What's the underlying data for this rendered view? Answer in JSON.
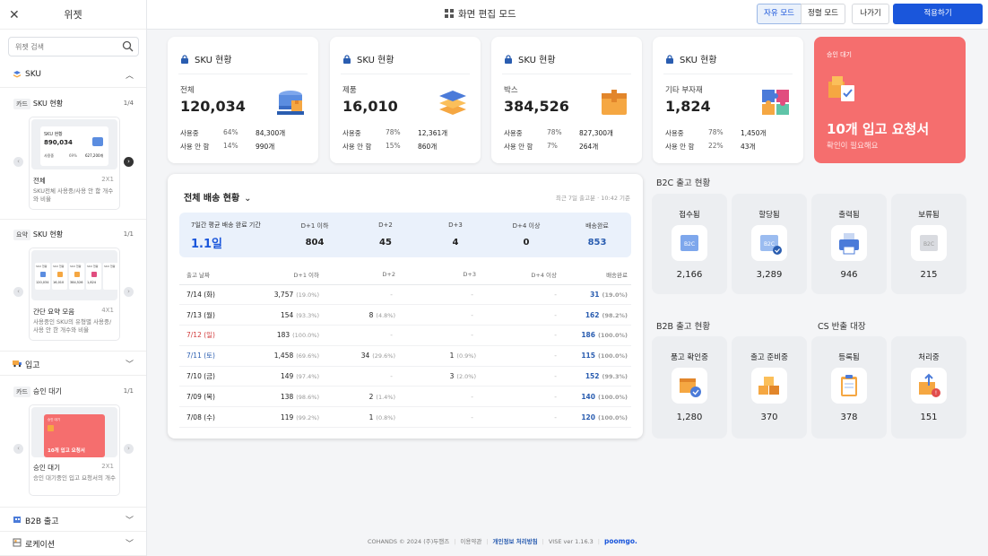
{
  "sidebar": {
    "title": "위젯",
    "search_placeholder": "위젯 검색",
    "sections": {
      "sku": "SKU",
      "inbound": "입고",
      "b2b": "B2B 출고",
      "location": "로케이션"
    },
    "groups": [
      {
        "tag": "카드",
        "title": "SKU 현황",
        "count": "1/4",
        "preview_title": "SKU 현황",
        "preview_value": "890,034",
        "preview_row_label": "사용중",
        "preview_row_pct": "69%",
        "preview_row_count": "627,200개",
        "name": "전체",
        "size": "2X1",
        "desc": "SKU전체 사용중/사용 안 함 개수와 비율"
      },
      {
        "tag": "요약",
        "title": "SKU 현황",
        "count": "1/1",
        "preview_labels": [
          "SKU 현황",
          "SKU 현황",
          "SKU 현황",
          "SKU 현황",
          "SKU 현황"
        ],
        "preview_values": [
          "120,034",
          "16,010",
          "384,526",
          "1,824",
          ""
        ],
        "name": "간단 요약 모음",
        "size": "4X1",
        "desc": "사용중인 SKU의 유형별 사용중/사용 안 한 개수와 비율"
      },
      {
        "tag": "카드",
        "title": "승인 대기",
        "count": "1/1",
        "preview_label": "승인 대기",
        "preview_title": "10개 입고 요청서",
        "name": "승인 대기",
        "size": "2X1",
        "desc": "승인 대기중인 입고 요청서의 개수"
      }
    ]
  },
  "topbar": {
    "mode_title": "화면 편집 모드",
    "free_mode": "자유 모드",
    "align_mode": "정렬 모드",
    "exit": "나가기",
    "apply": "적용하기"
  },
  "sku_cards": [
    {
      "title": "SKU 현황",
      "label": "전체",
      "value": "120,034",
      "used_label": "사용중",
      "used_pct": "64%",
      "used_count": "84,300개",
      "unused_label": "사용 안 함",
      "unused_pct": "14%",
      "unused_count": "990개",
      "icon": "pallet-box-icon"
    },
    {
      "title": "SKU 현황",
      "label": "제품",
      "value": "16,010",
      "used_label": "사용중",
      "used_pct": "78%",
      "used_count": "12,361개",
      "unused_label": "사용 안 함",
      "unused_pct": "15%",
      "unused_count": "860개",
      "icon": "layers-icon"
    },
    {
      "title": "SKU 현황",
      "label": "박스",
      "value": "384,526",
      "used_label": "사용중",
      "used_pct": "78%",
      "used_count": "827,300개",
      "unused_label": "사용 안 함",
      "unused_pct": "7%",
      "unused_count": "264개",
      "icon": "box-icon"
    },
    {
      "title": "SKU 현황",
      "label": "기타 부자재",
      "value": "1,824",
      "used_label": "사용중",
      "used_pct": "78%",
      "used_count": "1,450개",
      "unused_label": "사용 안 함",
      "unused_pct": "22%",
      "unused_count": "43개",
      "icon": "puzzle-icon"
    }
  ],
  "approval": {
    "label": "승인 대기",
    "title": "10개 입고 요청서",
    "sub": "확인이 필요해요"
  },
  "delivery": {
    "title": "전체 배송 현황",
    "note": "최근 7일 출고분 · 10:42 기준",
    "summary": {
      "avg_label": "7일간 평균 배송 완료 기간",
      "avg_value": "1.1일",
      "cols": [
        {
          "label": "D+1 이하",
          "value": "804"
        },
        {
          "label": "D+2",
          "value": "45"
        },
        {
          "label": "D+3",
          "value": "4"
        },
        {
          "label": "D+4 이상",
          "value": "0"
        },
        {
          "label": "배송완료",
          "value": "853"
        }
      ]
    },
    "headers": [
      "출고 날짜",
      "D+1 이하",
      "D+2",
      "D+3",
      "D+4 이상",
      "배송완료"
    ],
    "rows": [
      {
        "date": "7/14 (화)",
        "d1": "3,757",
        "d1p": "(19.0%)",
        "d2": "-",
        "d2p": "",
        "d3": "-",
        "d3p": "",
        "d4": "-",
        "done": "31",
        "donep": "(19.0%)",
        "color": "#222"
      },
      {
        "date": "7/13 (월)",
        "d1": "154",
        "d1p": "(93.3%)",
        "d2": "8",
        "d2p": "(4.8%)",
        "d3": "-",
        "d3p": "",
        "d4": "-",
        "done": "162",
        "donep": "(98.2%)",
        "color": "#222"
      },
      {
        "date": "7/12 (일)",
        "d1": "183",
        "d1p": "(100.0%)",
        "d2": "-",
        "d2p": "",
        "d3": "-",
        "d3p": "",
        "d4": "-",
        "done": "186",
        "donep": "(100.0%)",
        "color": "#d23a3a"
      },
      {
        "date": "7/11 (토)",
        "d1": "1,458",
        "d1p": "(69.6%)",
        "d2": "34",
        "d2p": "(29.6%)",
        "d3": "1",
        "d3p": "(0.9%)",
        "d4": "-",
        "done": "115",
        "donep": "(100.0%)",
        "color": "#2a5db0"
      },
      {
        "date": "7/10 (금)",
        "d1": "149",
        "d1p": "(97.4%)",
        "d2": "-",
        "d2p": "",
        "d3": "3",
        "d3p": "(2.0%)",
        "d4": "-",
        "done": "152",
        "donep": "(99.3%)",
        "color": "#222"
      },
      {
        "date": "7/09 (목)",
        "d1": "138",
        "d1p": "(98.6%)",
        "d2": "2",
        "d2p": "(1.4%)",
        "d3": "-",
        "d3p": "",
        "d4": "-",
        "done": "140",
        "donep": "(100.0%)",
        "color": "#222"
      },
      {
        "date": "7/08 (수)",
        "d1": "119",
        "d1p": "(99.2%)",
        "d2": "1",
        "d2p": "(0.8%)",
        "d3": "-",
        "d3p": "",
        "d4": "-",
        "done": "120",
        "donep": "(100.0%)",
        "color": "#222"
      }
    ]
  },
  "b2c": {
    "title": "B2C 출고 현황",
    "items": [
      {
        "label": "접수됨",
        "value": "2,166",
        "icon": "b2c-received-icon"
      },
      {
        "label": "할당됨",
        "value": "3,289",
        "icon": "b2c-assigned-icon"
      },
      {
        "label": "출력됨",
        "value": "946",
        "icon": "printer-icon"
      },
      {
        "label": "보류됨",
        "value": "215",
        "icon": "b2c-hold-icon"
      }
    ]
  },
  "b2b": {
    "title": "B2B 출고 현황",
    "items": [
      {
        "label": "품고 확인중",
        "value": "1,280",
        "icon": "box-check-icon"
      },
      {
        "label": "출고 준비중",
        "value": "370",
        "icon": "boxes-icon"
      }
    ]
  },
  "cs": {
    "title": "CS 반출 대장",
    "items": [
      {
        "label": "등록됨",
        "value": "378",
        "icon": "clipboard-icon"
      },
      {
        "label": "처리중",
        "value": "151",
        "icon": "box-return-icon"
      }
    ]
  },
  "footer": {
    "company": "COHANDS © 2024 (주)두핸즈",
    "terms": "이용약관",
    "privacy": "개인정보 처리방침",
    "version": "VISE ver 1.16.3",
    "brand": "poomgo."
  },
  "colors": {
    "accent": "#1a56db",
    "approval_bg": "#f56e6e",
    "highlight_blue": "#2a5db0",
    "weekend_red": "#d23a3a"
  }
}
